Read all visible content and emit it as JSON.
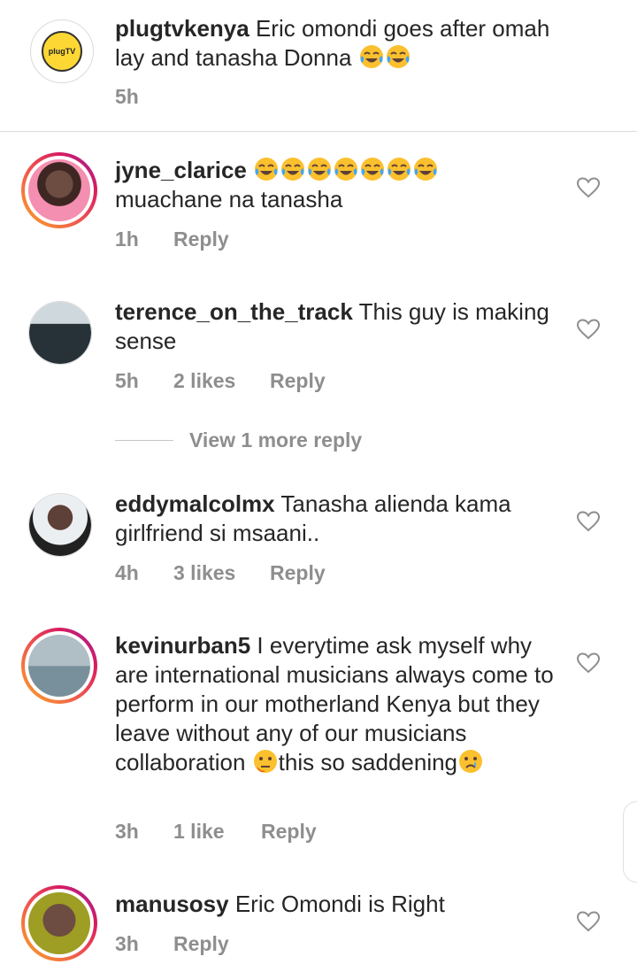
{
  "caption": {
    "username": "plugtvkenya",
    "text": "Eric omondi goes after omah lay and tanasha Donna",
    "time": "5h",
    "logo_text": "plugTV"
  },
  "comments": [
    {
      "username": "jyne_clarice",
      "text": "muachane na tanasha",
      "time": "1h",
      "likes": "",
      "reply": "Reply"
    },
    {
      "username": "terence_on_the_track",
      "text": "This guy is making sense",
      "time": "5h",
      "likes": "2 likes",
      "reply": "Reply"
    },
    {
      "username": "eddymalcolmx",
      "text": "Tanasha alienda kama girlfriend si msaani..",
      "time": "4h",
      "likes": "3 likes",
      "reply": "Reply"
    },
    {
      "username": "kevinurban5",
      "text": "I everytime ask myself why are international musicians always come to perform in our motherland Kenya but they leave without any of our musicians collaboration ",
      "text2": "this so saddening",
      "time": "3h",
      "likes": "1 like",
      "reply": "Reply"
    },
    {
      "username": "manusosy",
      "text": "Eric Omondi is Right",
      "time": "3h",
      "likes": "",
      "reply": "Reply"
    }
  ],
  "view_more": "View 1 more reply",
  "icons": {
    "like": "heart-outline-icon",
    "laugh": "tears-of-joy-emoji",
    "think": "thinking-face-emoji",
    "cry": "crying-face-emoji"
  },
  "colors": {
    "meta": "#8e8e8e",
    "text": "#262626",
    "story_ring": "#d81b60"
  }
}
